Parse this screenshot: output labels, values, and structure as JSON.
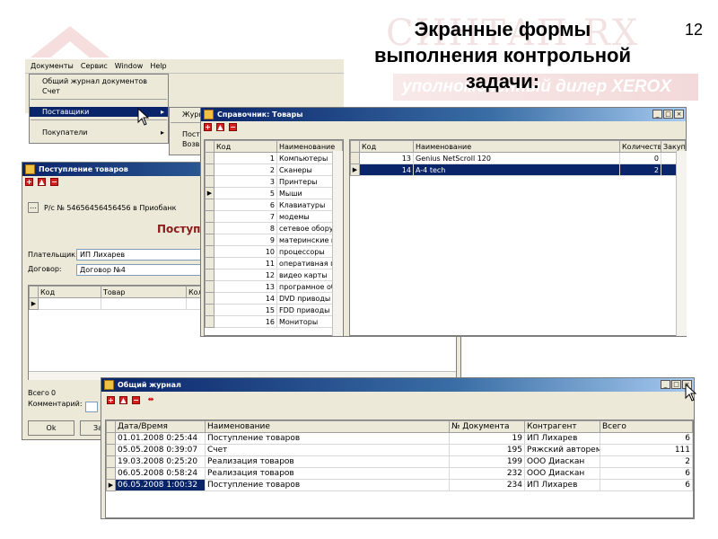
{
  "slide": {
    "title_lines": [
      "Экранные формы",
      "выполнения контрольной",
      "задачи:"
    ],
    "page_number": "12",
    "watermark_text": "СИНТАП-RX",
    "watermark_banner": "уполномоченный дилер XEROX"
  },
  "menubar": {
    "items": [
      "Документы",
      "Сервис",
      "Window",
      "Help"
    ],
    "documents_menu": {
      "items": [
        "Общий журнал документов",
        "Счет",
        "Поставщики",
        "Покупатели"
      ]
    },
    "suppliers_submenu": {
      "items": [
        "Журн",
        "Пост",
        "Возвр"
      ]
    }
  },
  "receipt_window": {
    "title": "Поступление товаров",
    "account_text": "Р/с № 54656456456456 в Приобанк",
    "heading": "Поступл",
    "payer_label": "Плательщик:",
    "payer_value": "ИП Лихарев",
    "contract_label": "Договор:",
    "contract_value": "Договор №4",
    "grid_columns": [
      "Код",
      "Товар",
      "Кол"
    ],
    "total_label": "Всего",
    "total_value": "0",
    "comment_label": "Комментарий:",
    "ok_button": "Ok",
    "other_button": "За"
  },
  "catalog_window": {
    "title": "Справочник: Товары",
    "left_columns": [
      "Код",
      "Наименование"
    ],
    "categories": [
      {
        "code": "1",
        "name": "Компьютеры"
      },
      {
        "code": "2",
        "name": "Сканеры"
      },
      {
        "code": "3",
        "name": "Принтеры"
      },
      {
        "code": "5",
        "name": "Мыши"
      },
      {
        "code": "6",
        "name": "Клавиатуры"
      },
      {
        "code": "7",
        "name": "модемы"
      },
      {
        "code": "8",
        "name": "сетевое оборуд"
      },
      {
        "code": "9",
        "name": "материнские пл"
      },
      {
        "code": "10",
        "name": "процессоры"
      },
      {
        "code": "11",
        "name": "оперативная па"
      },
      {
        "code": "12",
        "name": "видео карты"
      },
      {
        "code": "13",
        "name": "програмное обе"
      },
      {
        "code": "14",
        "name": "DVD приводы"
      },
      {
        "code": "15",
        "name": "FDD приводы"
      },
      {
        "code": "16",
        "name": "Мониторы"
      }
    ],
    "right_columns": [
      "Код",
      "Наименование",
      "Количество",
      "Закуп"
    ],
    "products": [
      {
        "code": "13",
        "name": "Genius NetScroll 120",
        "qty": "0"
      },
      {
        "code": "14",
        "name": "A-4 tech",
        "qty": "2"
      }
    ]
  },
  "journal_window": {
    "title": "Общий журнал",
    "columns": [
      "Дата/Время",
      "Наименование",
      "№ Документа",
      "Контрагент",
      "Всего"
    ],
    "rows": [
      {
        "date": "01.01.2008 0:25:44",
        "name": "Поступление товаров",
        "doc": "19",
        "party": "ИП Лихарев",
        "total": "6"
      },
      {
        "date": "05.05.2008 0:39:07",
        "name": "Счет",
        "doc": "195",
        "party": "Ряжский авторем",
        "total": "111"
      },
      {
        "date": "19.03.2008 0:25:20",
        "name": "Реализация товаров",
        "doc": "199",
        "party": "ООО Диаскан",
        "total": "2"
      },
      {
        "date": "06.05.2008 0:58:24",
        "name": "Реализация товаров",
        "doc": "232",
        "party": "ООО Диаскан",
        "total": "6"
      },
      {
        "date": "06.05.2008 1:00:32",
        "name": "Поступление товаров",
        "doc": "234",
        "party": "ИП Лихарев",
        "total": "6"
      }
    ]
  },
  "colors": {
    "titlebar": "#0a246a",
    "selection": "#0a246a",
    "window_face": "#ece9d8",
    "toolbar_button": "#d42020"
  }
}
